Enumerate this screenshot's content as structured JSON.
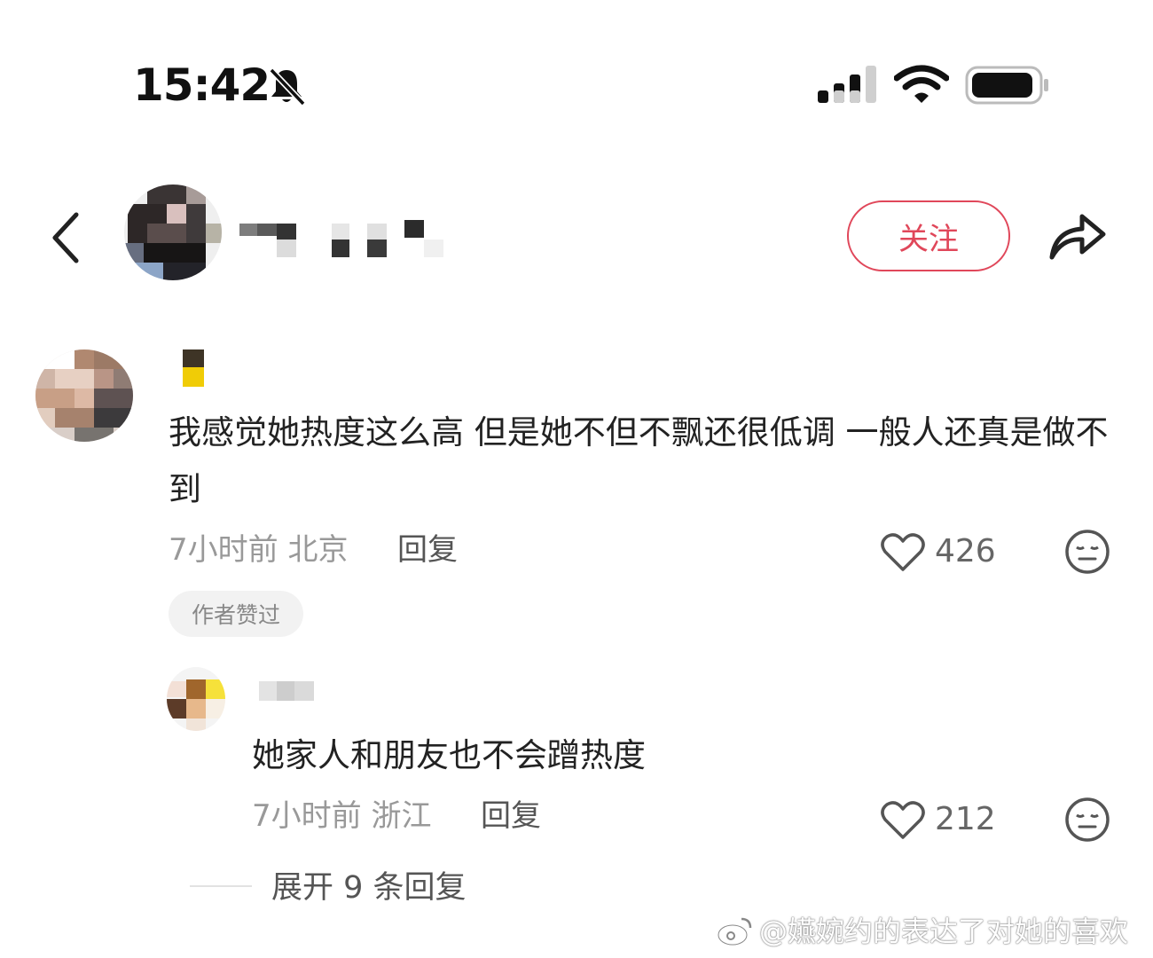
{
  "status_bar": {
    "time": "15:42"
  },
  "header": {
    "follow_label": "关注"
  },
  "comment": {
    "text": "我感觉她热度这么高 但是她不但不飘还很低调 一般人还真是做不到",
    "time": "7小时前",
    "location": "北京",
    "reply_label": "回复",
    "likes": "426",
    "badge": "作者赞过"
  },
  "reply": {
    "text": "她家人和朋友也不会蹭热度",
    "time": "7小时前",
    "location": "浙江",
    "reply_label": "回复",
    "likes": "212"
  },
  "expand_label": "展开 9 条回复",
  "watermark": "@嬿婉约的表达了对她的喜欢",
  "colors": {
    "accent": "#e0475a",
    "meta": "#999999",
    "text": "#222222"
  },
  "icons": [
    "bell-muted-icon",
    "signal-icon",
    "wifi-icon",
    "battery-icon",
    "back-icon",
    "share-icon",
    "heart-icon",
    "face-icon",
    "weibo-icon"
  ]
}
